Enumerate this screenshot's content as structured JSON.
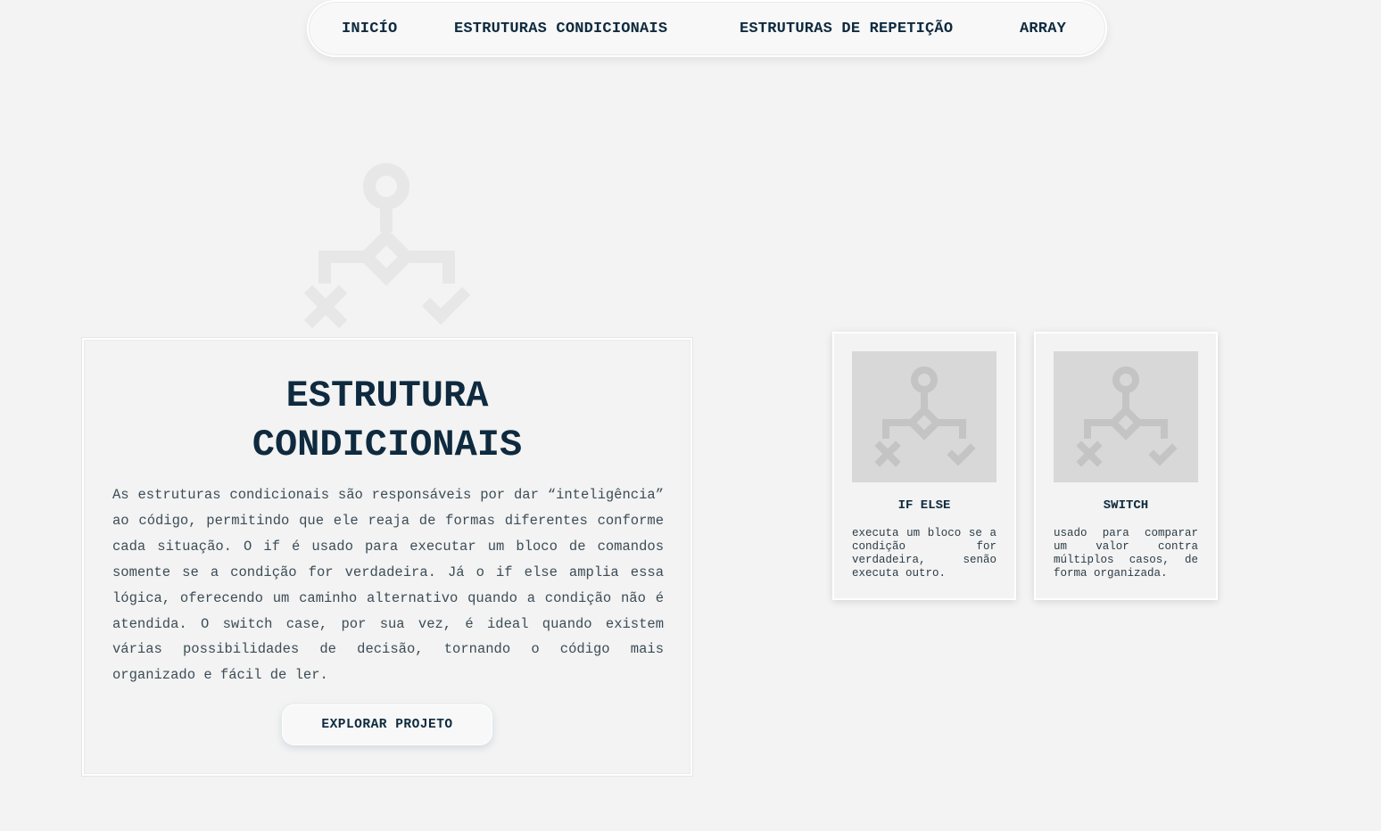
{
  "nav": {
    "items": [
      {
        "label": "INICÍO"
      },
      {
        "label": "ESTRUTURAS CONDICIONAIS"
      },
      {
        "label": "ESTRUTURAS DE REPETIÇÃO"
      },
      {
        "label": "ARRAY"
      }
    ]
  },
  "hero": {
    "icon": "flowchart-decision-icon",
    "title_line1": "ESTRUTURA",
    "title_line2": "CONDICIONAIS",
    "description": "As estruturas condicionais são responsáveis por dar “inteligência” ao código, permitindo que ele reaja de formas diferentes conforme cada situação. O if é usado para executar um bloco de comandos somente se a condição for verdadeira. Já o if else amplia essa lógica, oferecendo um caminho alternativo quando a condição não é atendida. O switch case, por sua vez, é ideal quando existem várias possibilidades de decisão, tornando o código mais organizado e fácil de ler.",
    "button_label": "EXPLORAR PROJETO"
  },
  "cards": [
    {
      "icon": "flowchart-decision-icon",
      "title": "IF ELSE",
      "text": "executa um bloco se a condição for verdadeira, senão executa outro."
    },
    {
      "icon": "flowchart-decision-icon",
      "title": "SWITCH",
      "text": "usado para comparar um valor contra múltiplos casos, de forma organizada."
    }
  ],
  "colors": {
    "background": "#f2f3f2",
    "text_dark": "#0f2a3f",
    "icon_light": "#e6e7e6",
    "icon_card": "#c4c4c4",
    "card_image_bg": "#d8d8d8"
  }
}
